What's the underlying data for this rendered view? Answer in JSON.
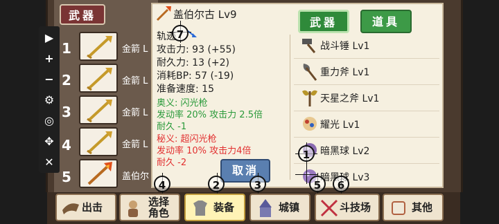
{
  "weapon_tab": "武器",
  "slots": [
    {
      "num": "1",
      "name": "金箭 L"
    },
    {
      "num": "2",
      "name": "金箭 L"
    },
    {
      "num": "3",
      "name": "金箭 L"
    },
    {
      "num": "4",
      "name": "金箭 L"
    },
    {
      "num": "5",
      "name": "盖伯尔"
    }
  ],
  "toolbar": [
    {
      "icon": "play-icon",
      "glyph": "▶"
    },
    {
      "icon": "plus-icon",
      "glyph": "+"
    },
    {
      "icon": "minus-icon",
      "glyph": "−"
    },
    {
      "icon": "gear-icon",
      "glyph": "⚙"
    },
    {
      "icon": "eye-slash-icon",
      "glyph": "◎"
    },
    {
      "icon": "move-icon",
      "glyph": "✥"
    },
    {
      "icon": "close-icon",
      "glyph": "✕"
    }
  ],
  "detail": {
    "title": "盖伯尔古 Lv9",
    "track": "轨迹",
    "stats": [
      "攻击力: 93 (+55)",
      "耐久力: 13 (+2)",
      "消耗BP: 57 (-19)",
      "准备速度: 15"
    ],
    "skill_green": [
      "奥义: 闪光枪",
      "发动率 20%    攻击力 2.5倍",
      "耐久 -1"
    ],
    "skill_red": [
      "秘义: 超闪光枪",
      "发动率 10%    攻击力4倍",
      "耐久 -2"
    ],
    "cancel": "取消"
  },
  "tabs": {
    "weapons": "武器",
    "items": "道具"
  },
  "weapon_list": [
    "战斗锤 Lv1",
    "重力斧 Lv1",
    "天星之斧 Lv1",
    "耀光 Lv1",
    "暗黑球 Lv2",
    "暗黑球 Lv3"
  ],
  "nav": [
    {
      "label": "出击"
    },
    {
      "label": "选择\n角色"
    },
    {
      "label": "装备"
    },
    {
      "label": "城镇"
    },
    {
      "label": "斗技场"
    },
    {
      "label": "其他"
    }
  ],
  "markers": [
    "7",
    "1",
    "2",
    "3",
    "4",
    "5",
    "6"
  ]
}
